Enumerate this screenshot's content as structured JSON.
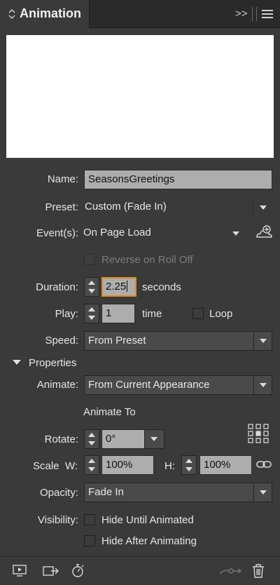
{
  "panel": {
    "title": "Animation",
    "collapse_glyph": "◇",
    "menu_overflow_glyph": ">>"
  },
  "form": {
    "name_label": "Name:",
    "name_value": "SeasonsGreetings",
    "preset_label": "Preset:",
    "preset_value": "Custom (Fade In)",
    "events_label": "Event(s):",
    "events_value": "On Page Load",
    "reverse_label": "Reverse on Roll Off",
    "duration_label": "Duration:",
    "duration_value": "2.25",
    "duration_unit": "seconds",
    "play_label": "Play:",
    "play_value": "1",
    "play_unit": "time",
    "loop_label": "Loop",
    "speed_label": "Speed:",
    "speed_value": "From Preset"
  },
  "properties": {
    "section_label": "Properties",
    "animate_label": "Animate:",
    "animate_value": "From Current Appearance",
    "animate_to_label": "Animate To",
    "rotate_label": "Rotate:",
    "rotate_value": "0°",
    "scale_label": "Scale",
    "scale_w_label": "W:",
    "scale_w_value": "100%",
    "scale_h_label": "H:",
    "scale_h_value": "100%",
    "opacity_label": "Opacity:",
    "opacity_value": "Fade In",
    "visibility_label": "Visibility:",
    "hide_until_label": "Hide Until Animated",
    "hide_after_label": "Hide After Animating"
  },
  "icons": {
    "collapse": "collapse-arrows-icon",
    "overflow": "overflow-arrows-icon",
    "menu": "panel-menu-icon",
    "events_add": "add-event-icon",
    "proxy_grid": "reference-point-icon",
    "constrain": "constrain-link-icon",
    "preview": "preview-spread-icon",
    "convert": "convert-to-button-icon",
    "timing": "timing-icon",
    "motion_path": "motion-path-icon",
    "delete": "trash-icon"
  },
  "colors": {
    "panel_bg": "#3a3a3a",
    "field_bg": "#adadad",
    "focus_border": "#e38a1a"
  }
}
